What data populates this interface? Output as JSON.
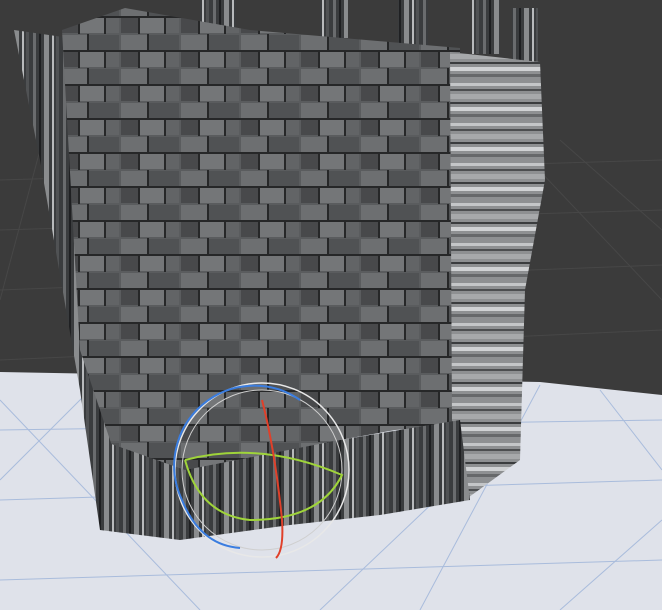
{
  "viewport": {
    "background_color": "#3b3b3b",
    "grid_color": "#4a4a4a",
    "ground_color": "#dfe2ea",
    "ground_grid_color": "#9fb4d8"
  },
  "gizmo": {
    "type": "rotate",
    "x_axis_color": "#e0402a",
    "y_axis_color": "#9fd43a",
    "z_axis_color": "#3a7de0",
    "outer_ring_color": "#e8e8e8"
  },
  "model": {
    "stone_color": "#5e6062",
    "stone_dark": "#2e3032",
    "stripe_light": "#a8aaac",
    "stripe_dark": "#4a4c4e"
  }
}
